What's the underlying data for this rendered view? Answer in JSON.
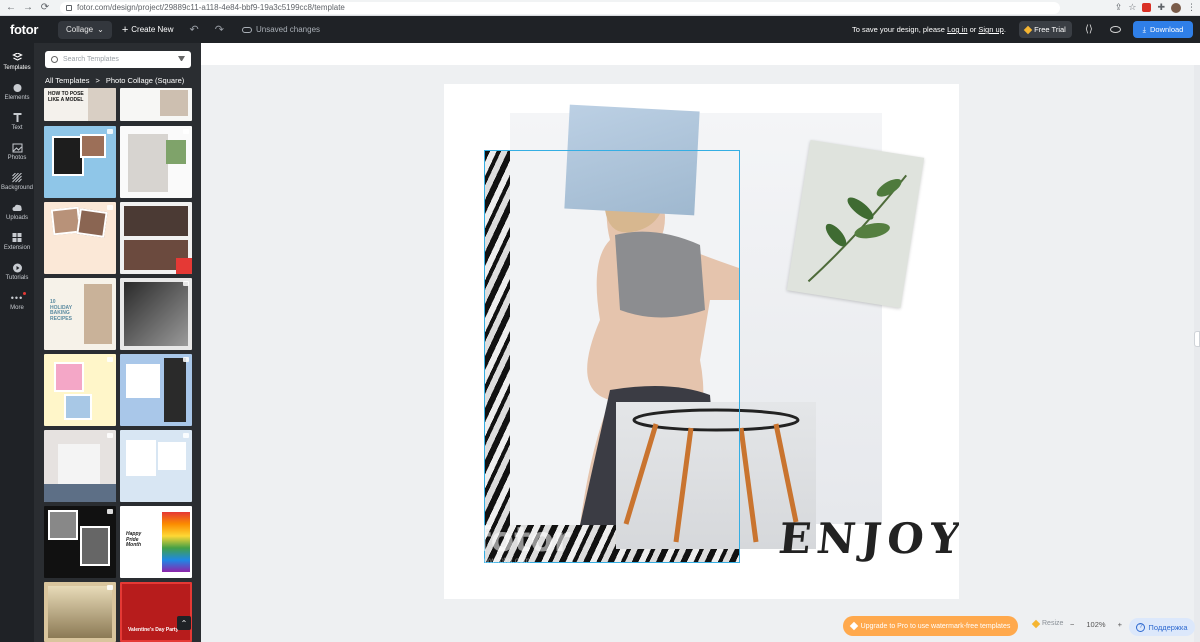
{
  "browser": {
    "url": "fotor.com/design/project/29889c11-a118-4e84-bbf9-19a3c5199cc8/template"
  },
  "topbar": {
    "logo": "fotor",
    "mode_label": "Collage",
    "create_label": "Create New",
    "unsaved_label": "Unsaved changes",
    "save_msg_prefix": "To save your design, please",
    "login_label": "Log in",
    "or_label": "or",
    "signup_label": "Sign up",
    "free_trial_label": "Free Trial",
    "download_label": "Download"
  },
  "rail": {
    "items": [
      {
        "label": "Templates",
        "icon": "templates-icon"
      },
      {
        "label": "Elements",
        "icon": "elements-icon"
      },
      {
        "label": "Text",
        "icon": "text-icon"
      },
      {
        "label": "Photos",
        "icon": "photos-icon"
      },
      {
        "label": "Background",
        "icon": "background-icon"
      },
      {
        "label": "Uploads",
        "icon": "uploads-icon"
      },
      {
        "label": "Extension",
        "icon": "extension-icon"
      },
      {
        "label": "Tutorials",
        "icon": "tutorials-icon"
      },
      {
        "label": "More",
        "icon": "more-icon"
      }
    ]
  },
  "panel": {
    "search_placeholder": "Search Templates",
    "breadcrumb_root": "All Templates",
    "breadcrumb_sep": ">",
    "breadcrumb_current": "Photo Collage (Square)",
    "thumb_texts": {
      "t1": "HOW TO POSE LIKE A MODEL",
      "t5": "10 HOLIDAY BAKING RECIPES",
      "t12": "Happy Pride Month",
      "t14": "Valentine's Day Party"
    }
  },
  "canvas": {
    "decor_text": "ENJOY",
    "watermark": "fotor",
    "watermark_url": "www.fotor.com"
  },
  "bottom": {
    "upgrade_label": "Upgrade to Pro to use watermark-free templates",
    "resize_label": "Resize",
    "zoom_minus": "−",
    "zoom_value": "102%",
    "zoom_plus": "+",
    "help_label": "Поддержка"
  },
  "colors": {
    "accent": "#2f7fe8",
    "upgrade": "#ffa94d",
    "dark": "#1f2226",
    "selection": "#35aee3"
  }
}
